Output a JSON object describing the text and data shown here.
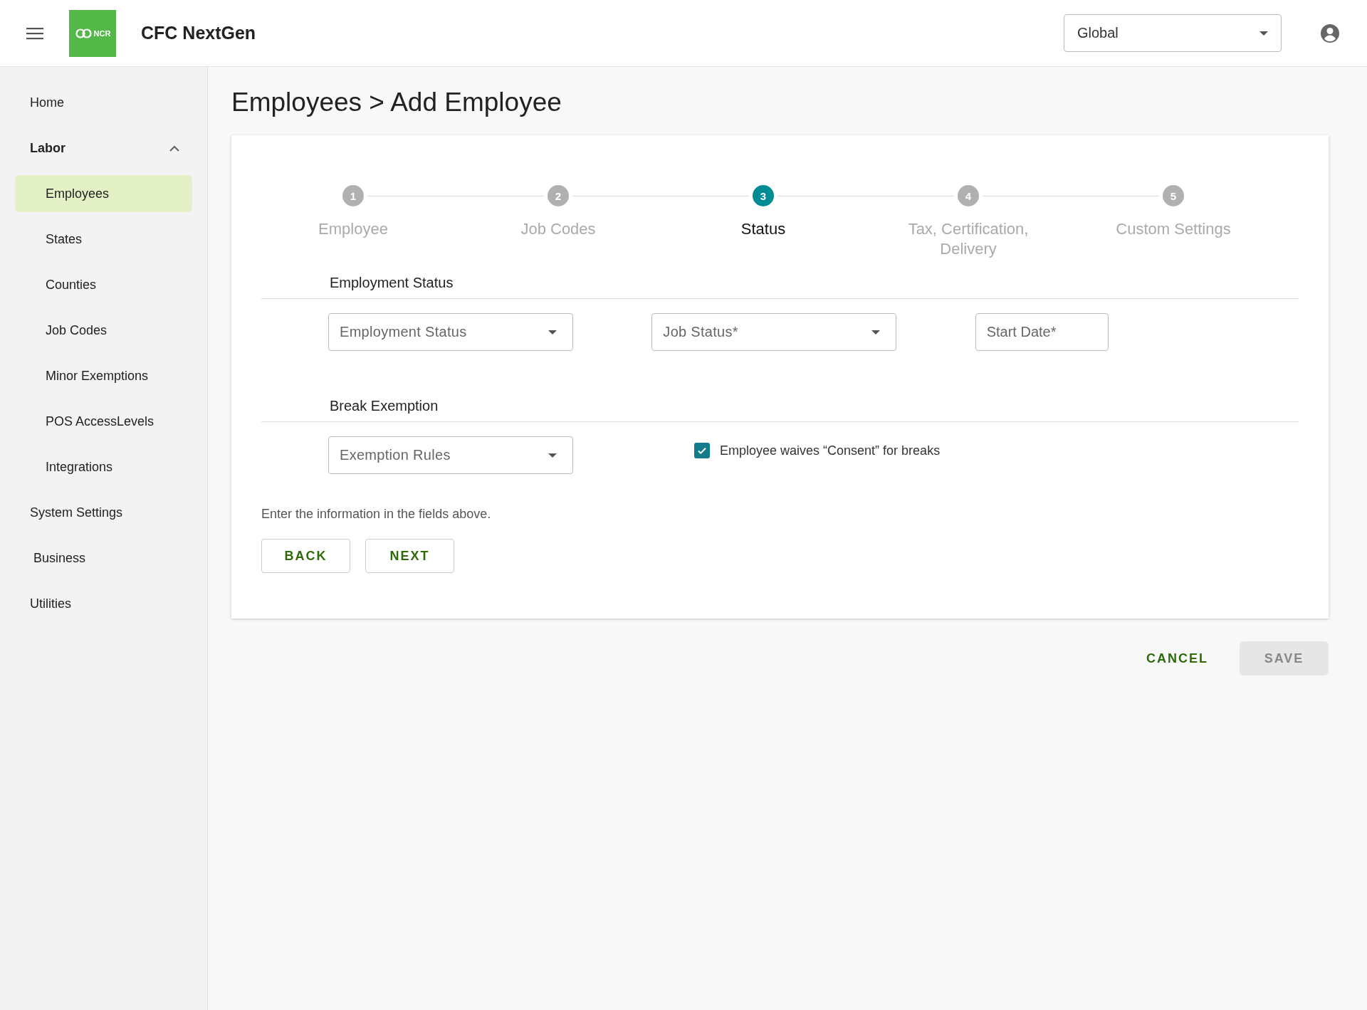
{
  "header": {
    "logo_text": "NCR",
    "app_title": "CFC NextGen",
    "scope_select": {
      "value": "Global"
    }
  },
  "sidebar": {
    "items": [
      {
        "label": "Home",
        "selected": false
      },
      {
        "label": "Labor",
        "selected": false,
        "expanded": true,
        "children": [
          {
            "label": "Employees",
            "selected": true
          },
          {
            "label": "States",
            "selected": false
          },
          {
            "label": "Counties",
            "selected": false
          },
          {
            "label": "Job Codes",
            "selected": false
          },
          {
            "label": "Minor Exemptions",
            "selected": false
          },
          {
            "label": "POS AccessLevels",
            "selected": false
          },
          {
            "label": "Integrations",
            "selected": false
          }
        ]
      },
      {
        "label": "System Settings",
        "selected": false
      },
      {
        "label": "Business",
        "selected": false
      },
      {
        "label": "Utilities",
        "selected": false
      }
    ]
  },
  "page_title": "Employees > Add Employee",
  "stepper": [
    {
      "number": "1",
      "label": "Employee",
      "selected": false
    },
    {
      "number": "2",
      "label": "Job Codes",
      "selected": false
    },
    {
      "number": "3",
      "label": "Status",
      "selected": true
    },
    {
      "number": "4",
      "label": "Tax, Certification, Delivery",
      "selected": false
    },
    {
      "number": "5",
      "label": "Custom Settings",
      "selected": false
    }
  ],
  "sections": [
    {
      "title": "Employment Status",
      "controls": [
        {
          "kind": "select",
          "placeholder": "Employment Status"
        },
        {
          "kind": "select",
          "placeholder": "Job Status*"
        },
        {
          "kind": "date",
          "placeholder": "Start Date*"
        }
      ]
    },
    {
      "title": "Break Exemption",
      "controls": [
        {
          "kind": "select",
          "placeholder": "Exemption Rules"
        },
        {
          "kind": "checkbox",
          "label": "Employee waives “Consent” for breaks",
          "checked": true
        }
      ]
    }
  ],
  "hint": "Enter the information in the fields above.",
  "step_buttons": [
    "BACK",
    "NEXT"
  ],
  "footer": {
    "cancel": {
      "label": "CANCEL",
      "disabled": false
    },
    "save": {
      "label": "SAVE",
      "disabled": true
    }
  }
}
